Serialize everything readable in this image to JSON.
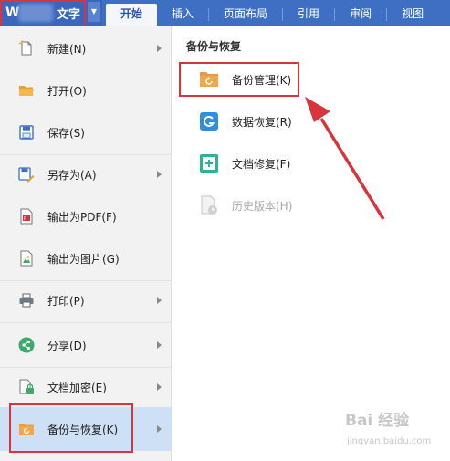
{
  "topbar": {
    "app_logo": "W",
    "app_label": "文字",
    "dropdown_glyph": "▼",
    "tabs": [
      {
        "label": "开始",
        "active": true
      },
      {
        "label": "插入",
        "active": false
      },
      {
        "label": "页面布局",
        "active": false
      },
      {
        "label": "引用",
        "active": false
      },
      {
        "label": "审阅",
        "active": false
      },
      {
        "label": "视图",
        "active": false
      }
    ]
  },
  "menu": {
    "items": [
      {
        "label": "新建(N)",
        "icon": "new-doc-icon",
        "has_arrow": true
      },
      {
        "label": "打开(O)",
        "icon": "folder-open-icon",
        "has_arrow": false
      },
      {
        "label": "保存(S)",
        "icon": "save-icon",
        "has_arrow": false
      },
      {
        "label": "另存为(A)",
        "icon": "save-as-icon",
        "has_arrow": true
      },
      {
        "label": "输出为PDF(F)",
        "icon": "pdf-icon",
        "has_arrow": false
      },
      {
        "label": "输出为图片(G)",
        "icon": "image-export-icon",
        "has_arrow": false
      },
      {
        "label": "打印(P)",
        "icon": "printer-icon",
        "has_arrow": true
      },
      {
        "label": "分享(D)",
        "icon": "share-icon",
        "has_arrow": true
      },
      {
        "label": "文档加密(E)",
        "icon": "lock-doc-icon",
        "has_arrow": true
      },
      {
        "label": "备份与恢复(K)",
        "icon": "backup-icon",
        "has_arrow": true,
        "active": true
      }
    ]
  },
  "submenu": {
    "title": "备份与恢复",
    "items": [
      {
        "label": "备份管理(K)",
        "icon": "backup-manage-icon",
        "enabled": true
      },
      {
        "label": "数据恢复(R)",
        "icon": "data-recovery-icon",
        "enabled": true
      },
      {
        "label": "文档修复(F)",
        "icon": "doc-repair-icon",
        "enabled": true
      },
      {
        "label": "历史版本(H)",
        "icon": "history-version-icon",
        "enabled": false
      }
    ]
  },
  "colors": {
    "topbar": "#3f6fc3",
    "highlight": "#d8343b",
    "active_row": "#cde0f6"
  },
  "watermark": {
    "text": "Bai 经验",
    "sub": "jingyan.baidu.com"
  }
}
